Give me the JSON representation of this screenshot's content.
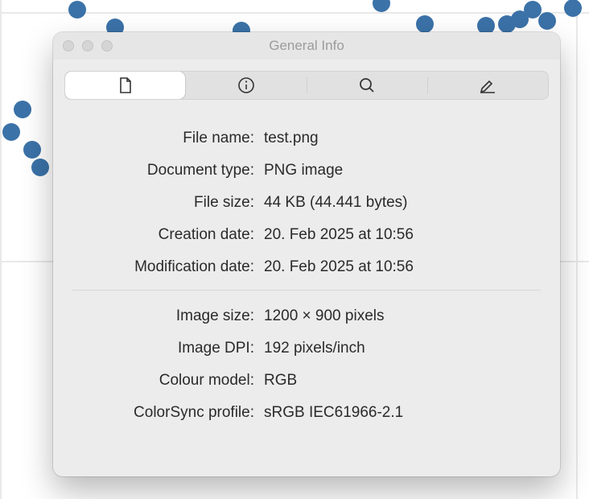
{
  "window": {
    "title": "General Info"
  },
  "tabs": {
    "file": "file-tab",
    "info": "info-tab",
    "search": "search-tab",
    "edit": "edit-tab"
  },
  "labels": {
    "file_name": "File name:",
    "document_type": "Document type:",
    "file_size": "File size:",
    "creation_date": "Creation date:",
    "modification_date": "Modification date:",
    "image_size": "Image size:",
    "image_dpi": "Image DPI:",
    "colour_model": "Colour model:",
    "colorsync_profile": "ColorSync profile:"
  },
  "values": {
    "file_name": "test.png",
    "document_type": "PNG image",
    "file_size": "44 KB (44.441 bytes)",
    "creation_date": "20. Feb 2025 at 10:56",
    "modification_date": "20. Feb 2025 at 10:56",
    "image_size": "1200 × 900 pixels",
    "image_dpi": "192 pixels/inch",
    "colour_model": "RGB",
    "colorsync_profile": "sRGB IEC61966-2.1"
  }
}
